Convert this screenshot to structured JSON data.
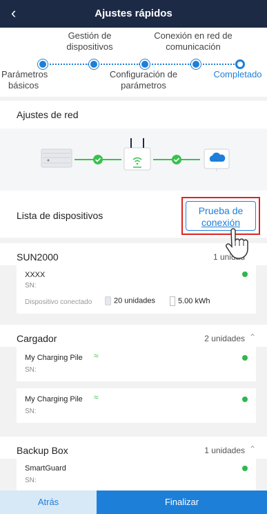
{
  "header": {
    "title": "Ajustes rápidos",
    "back_icon": "chevron-left-icon"
  },
  "stepper": {
    "top_labels": [
      "Gestión de\ndispositivos",
      "Conexión en red de\ncomunicación"
    ],
    "bottom_labels": [
      "Parámetros\nbásicos",
      "Configuración de\nparámetros",
      "Completado"
    ],
    "step1": "Parámetros",
    "step1b": "básicos",
    "step2": "Gestión de",
    "step2b": "dispositivos",
    "step3": "Configuración de",
    "step3b": "parámetros",
    "step4": "Conexión en red de",
    "step4b": "comunicación",
    "step5": "Completado",
    "accent": "#1e7fd9"
  },
  "network": {
    "title": "Ajustes de red"
  },
  "devices": {
    "title": "Lista de dispositivos",
    "test_button": {
      "line1": "Prueba de",
      "line2": "conexión"
    },
    "groups": [
      {
        "name": "SUN2000",
        "count": "1 unidad",
        "items": [
          {
            "name": "XXXX",
            "sn": "SN:",
            "connected_label": "Dispositivo conectado",
            "units": "20 unidades",
            "energy": "5.00 kWh"
          }
        ]
      },
      {
        "name": "Cargador",
        "count": "2 unidades",
        "items": [
          {
            "name": "My Charging Pile",
            "sn": "SN:"
          },
          {
            "name": "My Charging Pile",
            "sn": "SN:"
          }
        ]
      },
      {
        "name": "Backup Box",
        "count": "1 unidades",
        "items": [
          {
            "name": "SmartGuard",
            "sn": "SN:"
          }
        ]
      }
    ]
  },
  "footer": {
    "back": "Atrás",
    "finish": "Finalizar"
  },
  "colors": {
    "header_bg": "#1c2a45",
    "status_ok": "#2db84d",
    "highlight": "#e02020"
  }
}
